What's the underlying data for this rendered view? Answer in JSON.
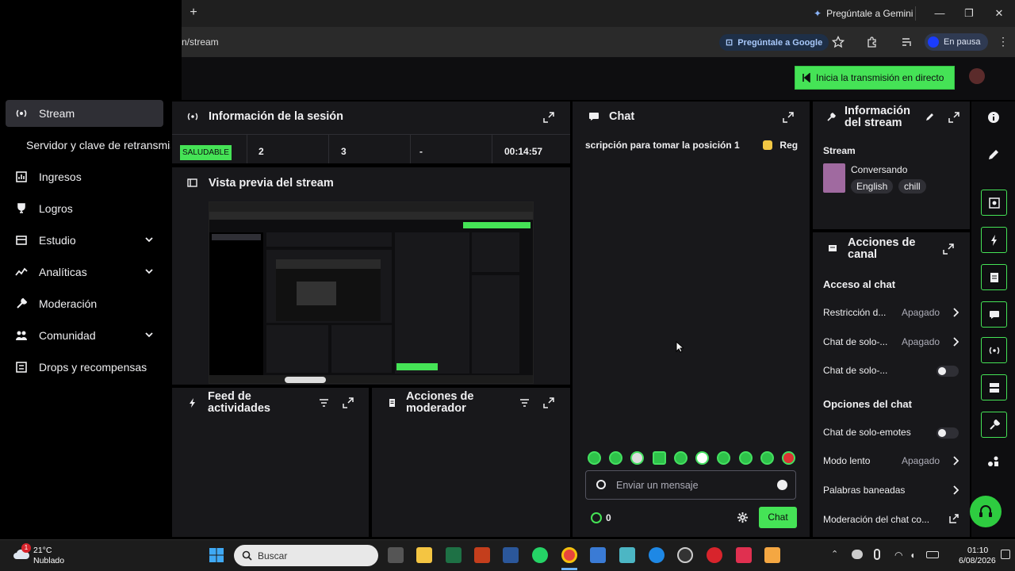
{
  "browser": {
    "url_fragment": "n/stream",
    "gemini_label": "Pregúntale a Gemini",
    "google_label": "Pregúntale a Google",
    "profile_label": "En pausa"
  },
  "topbar": {
    "go_live": "Inicia la transmisión en directo"
  },
  "sidebar": {
    "items": [
      {
        "label": "Stream"
      },
      {
        "label": "Servidor y clave de retransmisión"
      },
      {
        "label": "Ingresos"
      },
      {
        "label": "Logros"
      },
      {
        "label": "Estudio"
      },
      {
        "label": "Analíticas"
      },
      {
        "label": "Moderación"
      },
      {
        "label": "Comunidad"
      },
      {
        "label": "Drops y recompensas"
      }
    ]
  },
  "session": {
    "title": "Información de la sesión",
    "health": "SALUDABLE",
    "stat1": "2",
    "stat2": "3",
    "stat3": "-",
    "uptime": "00:14:57"
  },
  "preview": {
    "title": "Vista previa del stream"
  },
  "feed": {
    "title_line1": "Feed de",
    "title_line2": "actividades"
  },
  "modactions": {
    "title_line1": "Acciones de",
    "title_line2": "moderador"
  },
  "chat": {
    "title": "Chat",
    "ticker": "scripción para tomar la posición 1",
    "ticker_gift": "Regala",
    "input_placeholder": "Enviar un mensaje",
    "points": "0",
    "send_label": "Chat"
  },
  "stream_info": {
    "title_line1": "Información",
    "title_line2": "del stream",
    "section": "Stream",
    "category": "Conversando",
    "tags": [
      "English",
      "chill"
    ]
  },
  "channel_actions": {
    "title_line1": "Acciones de",
    "title_line2": "canal",
    "chat_access": "Acceso al chat",
    "restriction_label": "Restricción d...",
    "restriction_value": "Apagado",
    "solo1_label": "Chat de solo-...",
    "solo1_value": "Apagado",
    "solo2_label": "Chat de solo-...",
    "chat_options": "Opciones del chat",
    "emotes_label": "Chat de solo-emotes",
    "slow_label": "Modo lento",
    "slow_value": "Apagado",
    "banned_label": "Palabras baneadas",
    "chatmod_label": "Moderación del chat co..."
  },
  "taskbar": {
    "temp": "21°C",
    "weather": "Nublado",
    "weather_badge": "1",
    "search": "Buscar",
    "time": "01:10",
    "date": "6/08/2026"
  },
  "colors": {
    "accent": "#45e356",
    "panel": "#18181b",
    "bg": "#0e0e10"
  }
}
